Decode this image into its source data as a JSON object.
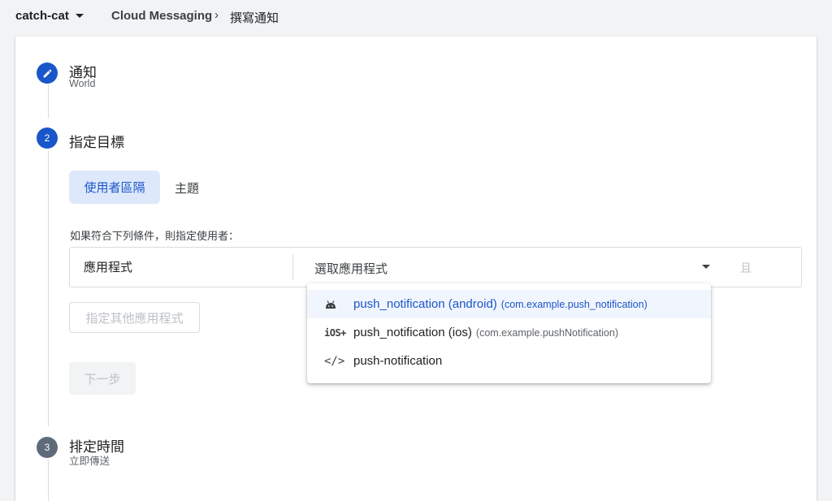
{
  "header": {
    "project": "catch-cat",
    "product": "Cloud Messaging",
    "separator": "›",
    "page": "撰寫通知"
  },
  "steps": [
    {
      "number": "",
      "title": "通知",
      "subtitle": "World",
      "state": "done",
      "icon": "pencil-icon"
    },
    {
      "number": "2",
      "title": "指定目標",
      "state": "active"
    },
    {
      "number": "3",
      "title": "排定時間",
      "subtitle": "立即傳送",
      "state": "pending"
    }
  ],
  "targeting": {
    "tabs": [
      {
        "label": "使用者區隔",
        "selected": true
      },
      {
        "label": "主題",
        "selected": false
      }
    ],
    "condition_label": "如果符合下列條件，則指定使用者：",
    "condition": {
      "field": "應用程式",
      "select_placeholder": "選取應用程式",
      "and_label": "且"
    },
    "other_app_button": "指定其他應用程式",
    "next_button": "下一步"
  },
  "dropdown": {
    "options": [
      {
        "icon": "android-icon",
        "name": "push_notification (android)",
        "package": "(com.example.push_notification)",
        "highlighted": true
      },
      {
        "icon": "ios-icon",
        "icon_text": "iOS+",
        "name": "push_notification (ios)",
        "package": "(com.example.pushNotification)",
        "highlighted": false
      },
      {
        "icon": "code-icon",
        "icon_text": "</>",
        "name": "push-notification",
        "package": "",
        "highlighted": false
      }
    ]
  },
  "colors": {
    "accent": "#1a56c9",
    "accent_light": "#dde8fb",
    "pending_step": "#5f6b7a"
  }
}
